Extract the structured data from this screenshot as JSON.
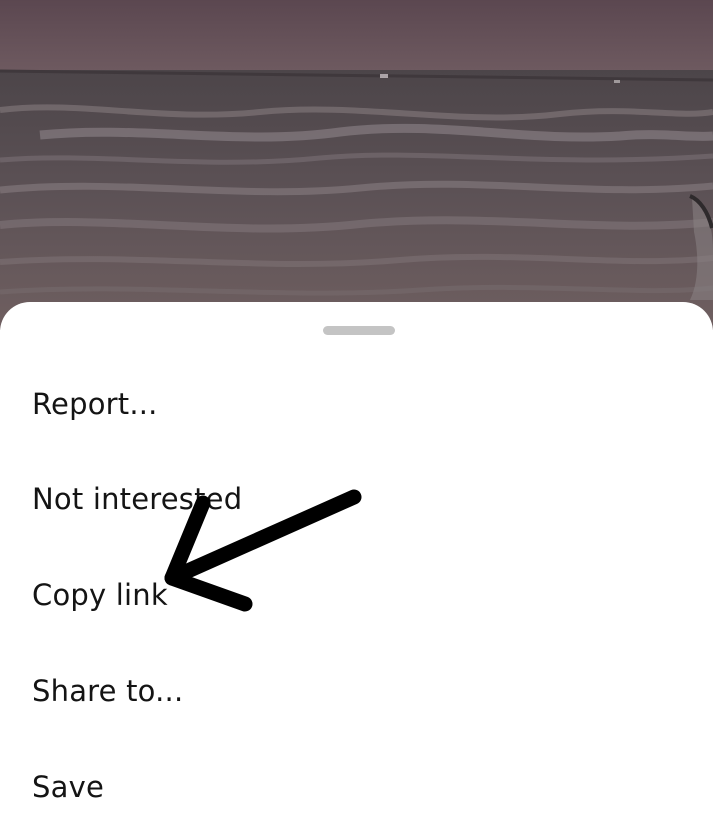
{
  "menu": {
    "items": [
      {
        "label": "Report..."
      },
      {
        "label": "Not interested"
      },
      {
        "label": "Copy link"
      },
      {
        "label": "Share to..."
      },
      {
        "label": "Save"
      }
    ]
  },
  "colors": {
    "sheet_background": "#ffffff",
    "handle": "#c4c4c4",
    "text": "#141414",
    "annotation_arrow": "#000000"
  },
  "icons": {
    "annotation": "arrow-pointing-to-copy-link"
  }
}
